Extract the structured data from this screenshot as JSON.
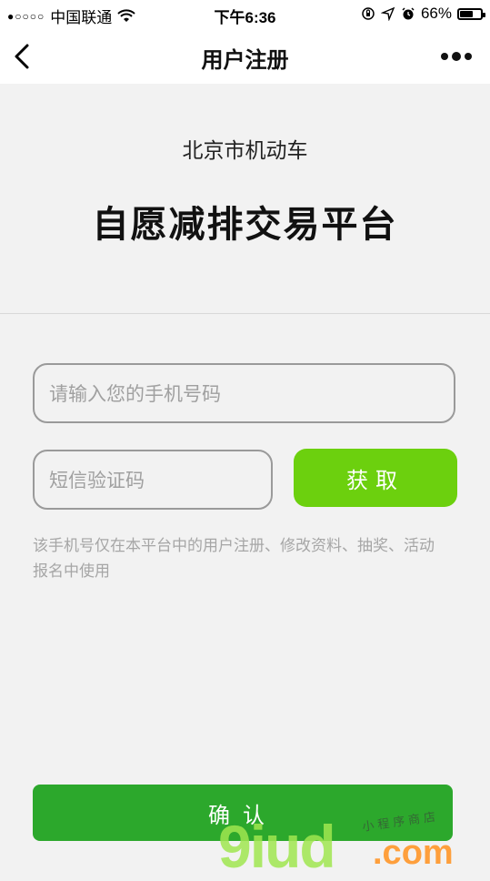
{
  "status_bar": {
    "signal": "●○○○○",
    "carrier": "中国联通",
    "time": "下午6:36",
    "battery_percent": "66%",
    "battery_level": 0.66
  },
  "nav": {
    "title": "用户注册"
  },
  "header": {
    "subtitle": "北京市机动车",
    "title": "自愿减排交易平台"
  },
  "form": {
    "phone_placeholder": "请输入您的手机号码",
    "code_placeholder": "短信验证码",
    "get_code_label": "获取",
    "hint": "该手机号仅在本平台中的用户注册、修改资料、抽奖、活动报名中使用"
  },
  "confirm_label": "确认",
  "watermark": {
    "main": "9iud",
    "suffix": ".com",
    "small": "小程序商店"
  },
  "colors": {
    "get_button": "#6cd00e",
    "confirm_button": "#2ca82c",
    "background": "#f2f2f2"
  }
}
